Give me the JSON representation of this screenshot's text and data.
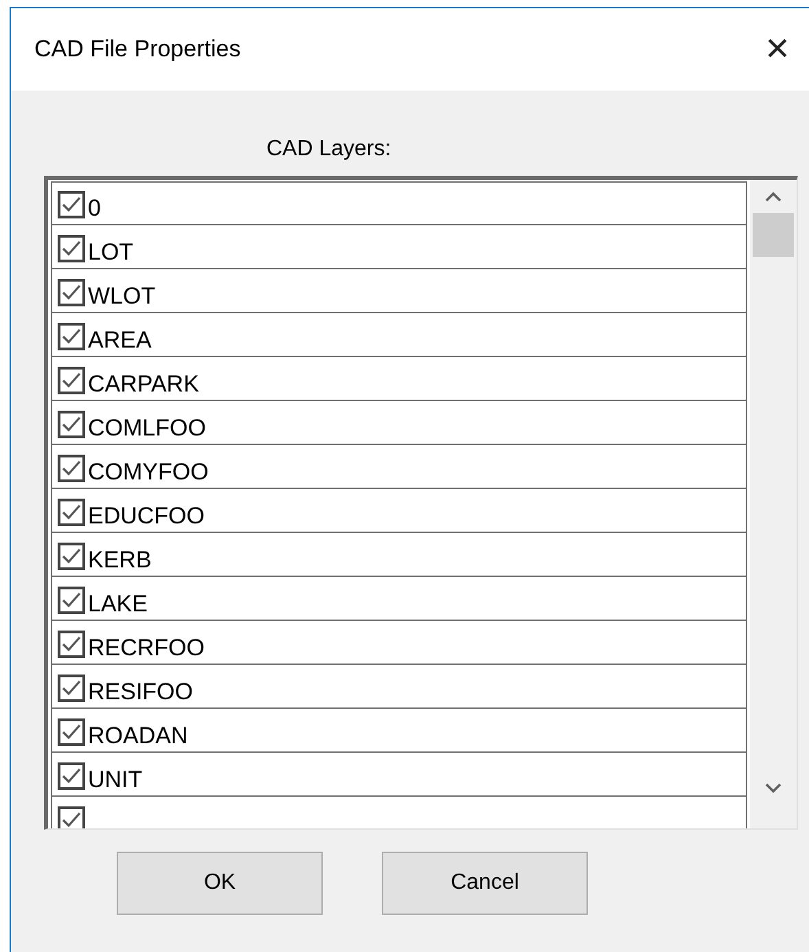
{
  "window": {
    "title": "CAD File Properties",
    "close": "×"
  },
  "layers_label": "CAD Layers:",
  "layers": [
    {
      "name": "0",
      "checked": true
    },
    {
      "name": "LOT",
      "checked": true
    },
    {
      "name": "WLOT",
      "checked": true
    },
    {
      "name": "AREA",
      "checked": true
    },
    {
      "name": "CARPARK",
      "checked": true
    },
    {
      "name": "COMLFOO",
      "checked": true
    },
    {
      "name": "COMYFOO",
      "checked": true
    },
    {
      "name": "EDUCFOO",
      "checked": true
    },
    {
      "name": "KERB",
      "checked": true
    },
    {
      "name": "LAKE",
      "checked": true
    },
    {
      "name": "RECRFOO",
      "checked": true
    },
    {
      "name": "RESIFOO",
      "checked": true
    },
    {
      "name": "ROADAN",
      "checked": true
    },
    {
      "name": "UNIT",
      "checked": true
    },
    {
      "checked": true
    }
  ],
  "buttons": [
    "OK",
    "Cancel"
  ]
}
